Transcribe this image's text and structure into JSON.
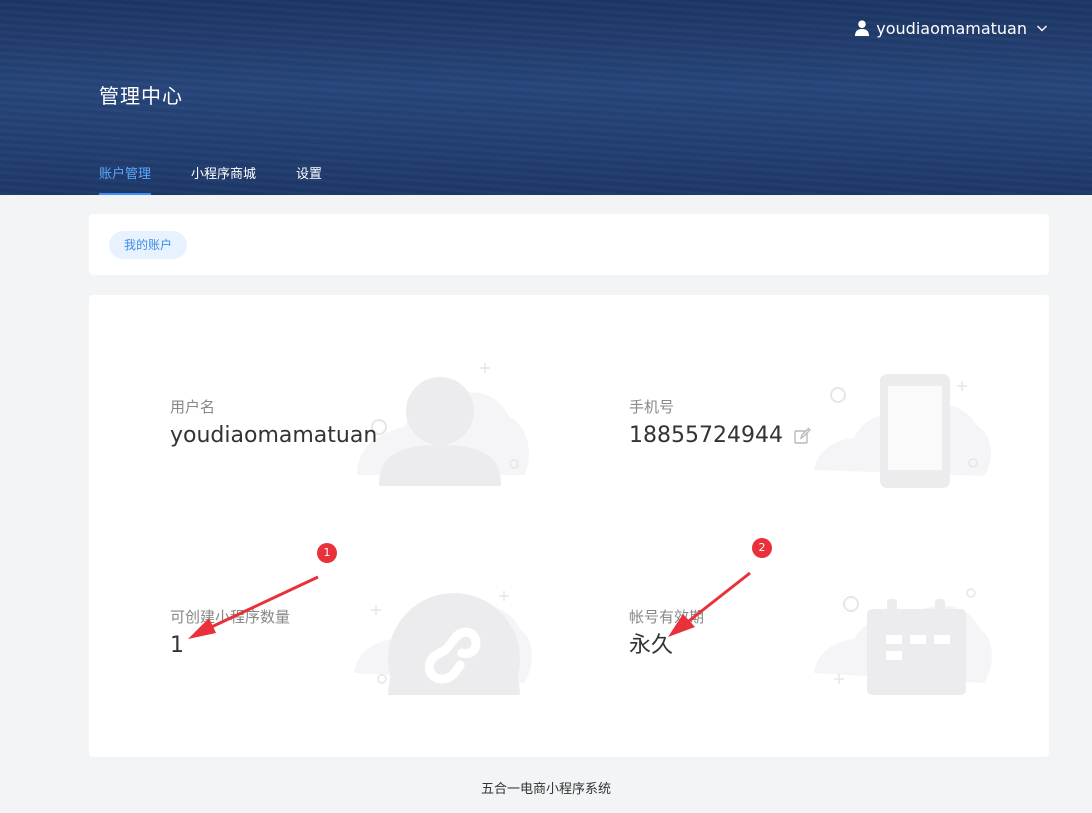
{
  "header": {
    "username": "youdiaomamatuan",
    "title": "管理中心",
    "tabs": [
      {
        "label": "账户管理"
      },
      {
        "label": "小程序商城"
      },
      {
        "label": "设置"
      }
    ]
  },
  "subnav": {
    "pill_label": "我的账户"
  },
  "account": {
    "username_label": "用户名",
    "username_value": "youdiaomamatuan",
    "phone_label": "手机号",
    "phone_value": "18855724944",
    "quota_label": "可创建小程序数量",
    "quota_value": "1",
    "validity_label": "帐号有效期",
    "validity_value": "永久"
  },
  "annotations": {
    "badge1": "1",
    "badge2": "2"
  },
  "footer": {
    "text": "五合一电商小程序系统"
  },
  "colors": {
    "header_bg": "#213d70",
    "accent": "#3f8dfa",
    "badge": "#e8313a",
    "illustration": "#f0f0f2"
  },
  "icons": [
    "person-icon",
    "chevron-down-icon",
    "edit-icon"
  ]
}
